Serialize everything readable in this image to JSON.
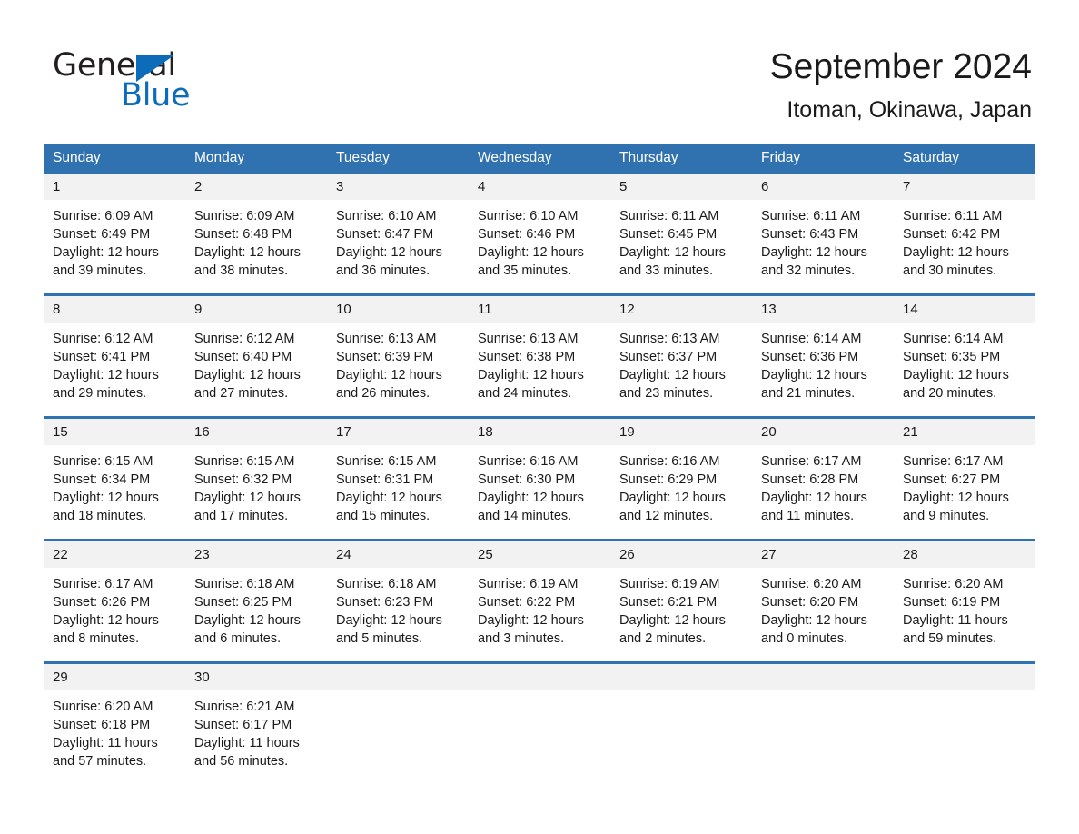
{
  "brand": {
    "name_part1": "General",
    "name_part2": "Blue",
    "triangle_color": "#0d6cb9"
  },
  "header": {
    "title": "September 2024",
    "subtitle": "Itoman, Okinawa, Japan",
    "accent_color": "#3071B0",
    "daynum_band_color": "#f2f2f2"
  },
  "calendar": {
    "weekday_headers": [
      "Sunday",
      "Monday",
      "Tuesday",
      "Wednesday",
      "Thursday",
      "Friday",
      "Saturday"
    ],
    "weeks": [
      [
        {
          "day": "1",
          "sunrise": "Sunrise: 6:09 AM",
          "sunset": "Sunset: 6:49 PM",
          "daylight_line1": "Daylight: 12 hours",
          "daylight_line2": "and 39 minutes."
        },
        {
          "day": "2",
          "sunrise": "Sunrise: 6:09 AM",
          "sunset": "Sunset: 6:48 PM",
          "daylight_line1": "Daylight: 12 hours",
          "daylight_line2": "and 38 minutes."
        },
        {
          "day": "3",
          "sunrise": "Sunrise: 6:10 AM",
          "sunset": "Sunset: 6:47 PM",
          "daylight_line1": "Daylight: 12 hours",
          "daylight_line2": "and 36 minutes."
        },
        {
          "day": "4",
          "sunrise": "Sunrise: 6:10 AM",
          "sunset": "Sunset: 6:46 PM",
          "daylight_line1": "Daylight: 12 hours",
          "daylight_line2": "and 35 minutes."
        },
        {
          "day": "5",
          "sunrise": "Sunrise: 6:11 AM",
          "sunset": "Sunset: 6:45 PM",
          "daylight_line1": "Daylight: 12 hours",
          "daylight_line2": "and 33 minutes."
        },
        {
          "day": "6",
          "sunrise": "Sunrise: 6:11 AM",
          "sunset": "Sunset: 6:43 PM",
          "daylight_line1": "Daylight: 12 hours",
          "daylight_line2": "and 32 minutes."
        },
        {
          "day": "7",
          "sunrise": "Sunrise: 6:11 AM",
          "sunset": "Sunset: 6:42 PM",
          "daylight_line1": "Daylight: 12 hours",
          "daylight_line2": "and 30 minutes."
        }
      ],
      [
        {
          "day": "8",
          "sunrise": "Sunrise: 6:12 AM",
          "sunset": "Sunset: 6:41 PM",
          "daylight_line1": "Daylight: 12 hours",
          "daylight_line2": "and 29 minutes."
        },
        {
          "day": "9",
          "sunrise": "Sunrise: 6:12 AM",
          "sunset": "Sunset: 6:40 PM",
          "daylight_line1": "Daylight: 12 hours",
          "daylight_line2": "and 27 minutes."
        },
        {
          "day": "10",
          "sunrise": "Sunrise: 6:13 AM",
          "sunset": "Sunset: 6:39 PM",
          "daylight_line1": "Daylight: 12 hours",
          "daylight_line2": "and 26 minutes."
        },
        {
          "day": "11",
          "sunrise": "Sunrise: 6:13 AM",
          "sunset": "Sunset: 6:38 PM",
          "daylight_line1": "Daylight: 12 hours",
          "daylight_line2": "and 24 minutes."
        },
        {
          "day": "12",
          "sunrise": "Sunrise: 6:13 AM",
          "sunset": "Sunset: 6:37 PM",
          "daylight_line1": "Daylight: 12 hours",
          "daylight_line2": "and 23 minutes."
        },
        {
          "day": "13",
          "sunrise": "Sunrise: 6:14 AM",
          "sunset": "Sunset: 6:36 PM",
          "daylight_line1": "Daylight: 12 hours",
          "daylight_line2": "and 21 minutes."
        },
        {
          "day": "14",
          "sunrise": "Sunrise: 6:14 AM",
          "sunset": "Sunset: 6:35 PM",
          "daylight_line1": "Daylight: 12 hours",
          "daylight_line2": "and 20 minutes."
        }
      ],
      [
        {
          "day": "15",
          "sunrise": "Sunrise: 6:15 AM",
          "sunset": "Sunset: 6:34 PM",
          "daylight_line1": "Daylight: 12 hours",
          "daylight_line2": "and 18 minutes."
        },
        {
          "day": "16",
          "sunrise": "Sunrise: 6:15 AM",
          "sunset": "Sunset: 6:32 PM",
          "daylight_line1": "Daylight: 12 hours",
          "daylight_line2": "and 17 minutes."
        },
        {
          "day": "17",
          "sunrise": "Sunrise: 6:15 AM",
          "sunset": "Sunset: 6:31 PM",
          "daylight_line1": "Daylight: 12 hours",
          "daylight_line2": "and 15 minutes."
        },
        {
          "day": "18",
          "sunrise": "Sunrise: 6:16 AM",
          "sunset": "Sunset: 6:30 PM",
          "daylight_line1": "Daylight: 12 hours",
          "daylight_line2": "and 14 minutes."
        },
        {
          "day": "19",
          "sunrise": "Sunrise: 6:16 AM",
          "sunset": "Sunset: 6:29 PM",
          "daylight_line1": "Daylight: 12 hours",
          "daylight_line2": "and 12 minutes."
        },
        {
          "day": "20",
          "sunrise": "Sunrise: 6:17 AM",
          "sunset": "Sunset: 6:28 PM",
          "daylight_line1": "Daylight: 12 hours",
          "daylight_line2": "and 11 minutes."
        },
        {
          "day": "21",
          "sunrise": "Sunrise: 6:17 AM",
          "sunset": "Sunset: 6:27 PM",
          "daylight_line1": "Daylight: 12 hours",
          "daylight_line2": "and 9 minutes."
        }
      ],
      [
        {
          "day": "22",
          "sunrise": "Sunrise: 6:17 AM",
          "sunset": "Sunset: 6:26 PM",
          "daylight_line1": "Daylight: 12 hours",
          "daylight_line2": "and 8 minutes."
        },
        {
          "day": "23",
          "sunrise": "Sunrise: 6:18 AM",
          "sunset": "Sunset: 6:25 PM",
          "daylight_line1": "Daylight: 12 hours",
          "daylight_line2": "and 6 minutes."
        },
        {
          "day": "24",
          "sunrise": "Sunrise: 6:18 AM",
          "sunset": "Sunset: 6:23 PM",
          "daylight_line1": "Daylight: 12 hours",
          "daylight_line2": "and 5 minutes."
        },
        {
          "day": "25",
          "sunrise": "Sunrise: 6:19 AM",
          "sunset": "Sunset: 6:22 PM",
          "daylight_line1": "Daylight: 12 hours",
          "daylight_line2": "and 3 minutes."
        },
        {
          "day": "26",
          "sunrise": "Sunrise: 6:19 AM",
          "sunset": "Sunset: 6:21 PM",
          "daylight_line1": "Daylight: 12 hours",
          "daylight_line2": "and 2 minutes."
        },
        {
          "day": "27",
          "sunrise": "Sunrise: 6:20 AM",
          "sunset": "Sunset: 6:20 PM",
          "daylight_line1": "Daylight: 12 hours",
          "daylight_line2": "and 0 minutes."
        },
        {
          "day": "28",
          "sunrise": "Sunrise: 6:20 AM",
          "sunset": "Sunset: 6:19 PM",
          "daylight_line1": "Daylight: 11 hours",
          "daylight_line2": "and 59 minutes."
        }
      ],
      [
        {
          "day": "29",
          "sunrise": "Sunrise: 6:20 AM",
          "sunset": "Sunset: 6:18 PM",
          "daylight_line1": "Daylight: 11 hours",
          "daylight_line2": "and 57 minutes."
        },
        {
          "day": "30",
          "sunrise": "Sunrise: 6:21 AM",
          "sunset": "Sunset: 6:17 PM",
          "daylight_line1": "Daylight: 11 hours",
          "daylight_line2": "and 56 minutes."
        },
        {
          "day": "",
          "sunrise": "",
          "sunset": "",
          "daylight_line1": "",
          "daylight_line2": ""
        },
        {
          "day": "",
          "sunrise": "",
          "sunset": "",
          "daylight_line1": "",
          "daylight_line2": ""
        },
        {
          "day": "",
          "sunrise": "",
          "sunset": "",
          "daylight_line1": "",
          "daylight_line2": ""
        },
        {
          "day": "",
          "sunrise": "",
          "sunset": "",
          "daylight_line1": "",
          "daylight_line2": ""
        },
        {
          "day": "",
          "sunrise": "",
          "sunset": "",
          "daylight_line1": "",
          "daylight_line2": ""
        }
      ]
    ]
  }
}
